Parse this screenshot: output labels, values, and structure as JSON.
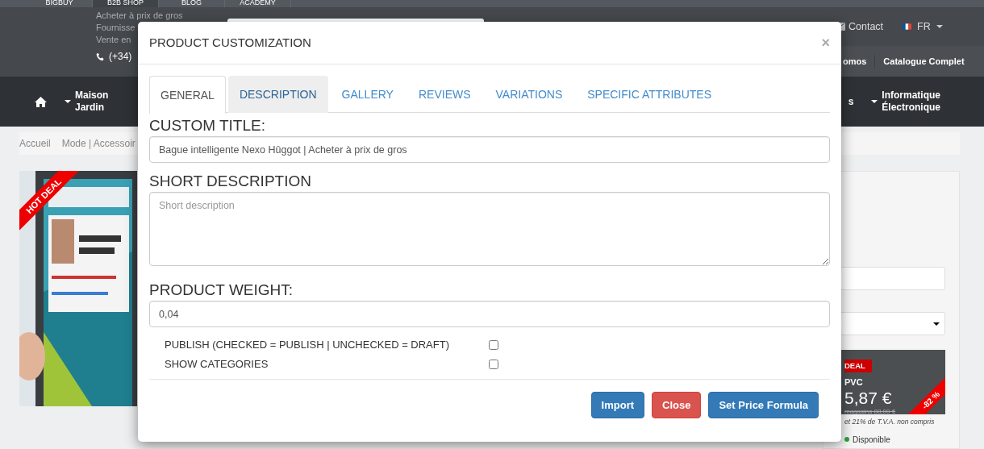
{
  "top_tabs": [
    {
      "label": "BIGBUY",
      "selected": false
    },
    {
      "label": "B2B SHOP",
      "selected": true
    },
    {
      "label": "BLOG",
      "selected": false
    },
    {
      "label": "ACADEMY",
      "selected": false
    }
  ],
  "header": {
    "tagline": [
      "Acheter à prix de gros",
      "Fournisse",
      "Vente en"
    ],
    "phone": "(+34)",
    "contact": "Contact",
    "language": "FR",
    "menu": [
      "omos",
      "Catalogue Complet"
    ]
  },
  "nav": [
    {
      "lines": [
        "Maison",
        "Jardin"
      ],
      "dropdown": true
    },
    {
      "lines": [
        "s"
      ],
      "dropdown": false
    },
    {
      "lines": [
        "Informatique",
        "Électronique"
      ],
      "dropdown": true
    }
  ],
  "breadcrumb": [
    "Accueil",
    "Mode | Accessoir"
  ],
  "product": {
    "ribbon": "HOT DEAL"
  },
  "price_box": {
    "badge": "DEAL",
    "label": "PVC",
    "price": "5,87 €",
    "old_price": "magasins 88,00 €",
    "discount": "-82 %",
    "tax_note": "et 21% de T.V.A. non compris",
    "stock": "Disponible"
  },
  "modal": {
    "title": "PRODUCT CUSTOMIZATION",
    "close": "×",
    "tabs": [
      {
        "label": "GENERAL",
        "selected": true,
        "hovered": false
      },
      {
        "label": "DESCRIPTION",
        "selected": false,
        "hovered": true
      },
      {
        "label": "GALLERY",
        "selected": false,
        "hovered": false
      },
      {
        "label": "REVIEWS",
        "selected": false,
        "hovered": false
      },
      {
        "label": "VARIATIONS",
        "selected": false,
        "hovered": false
      },
      {
        "label": "SPECIFIC ATTRIBUTES",
        "selected": false,
        "hovered": false
      }
    ],
    "fields": [
      {
        "kind": "input",
        "label": "CUSTOM TITLE:",
        "value": "Bague intelligente Nexo Hûggot | Acheter à prix de gros"
      },
      {
        "kind": "textarea",
        "label": "SHORT DESCRIPTION",
        "placeholder": "Short description"
      },
      {
        "kind": "input",
        "label": "PRODUCT WEIGHT:",
        "value": "0,04"
      }
    ],
    "checkboxes": [
      {
        "label": "PUBLISH (CHECKED = PUBLISH | UNCHECKED = DRAFT)",
        "checked": false
      },
      {
        "label": "SHOW CATEGORIES",
        "checked": false
      }
    ],
    "buttons": [
      {
        "label": "Import",
        "kind": "primary"
      },
      {
        "label": "Close",
        "kind": "danger"
      },
      {
        "label": "Set Price Formula",
        "kind": "primary"
      }
    ]
  }
}
